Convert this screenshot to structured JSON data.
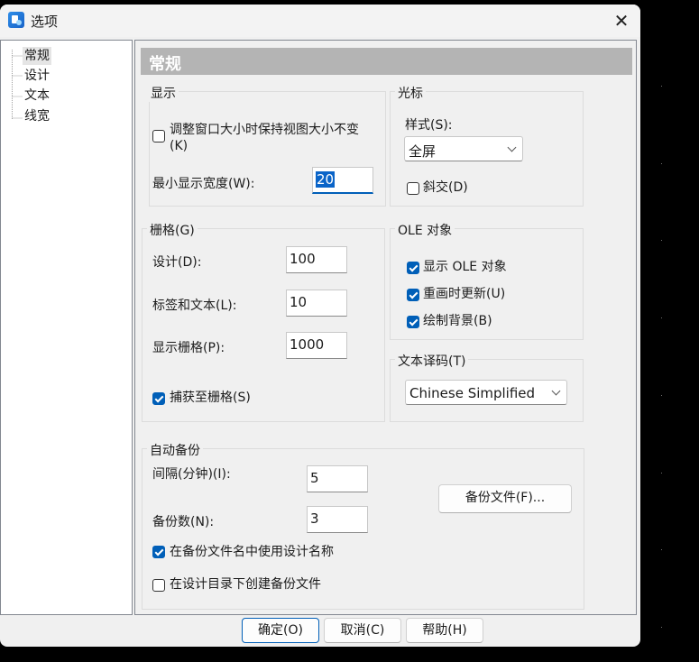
{
  "window": {
    "title": "选项",
    "close_symbol": "✕"
  },
  "tree": {
    "items": [
      "常规",
      "设计",
      "文本",
      "线宽"
    ],
    "selected": "常规"
  },
  "page_header": "常规",
  "display": {
    "group_label": "显示",
    "keep_view_size_line1": "调整窗口大小时保持视图大小不变",
    "keep_view_size_line2": "(K)",
    "keep_view_size_checked": false,
    "min_width_label": "最小显示宽度(W):",
    "min_width_value": "20"
  },
  "cursor": {
    "group_label": "光标",
    "style_label": "样式(S):",
    "style_value": "全屏",
    "oblique_label": "斜交(D)",
    "oblique_checked": false
  },
  "grid": {
    "group_label": "栅格(G)",
    "design_label": "设计(D):",
    "design_value": "100",
    "label_text_label": "标签和文本(L):",
    "label_text_value": "10",
    "display_label": "显示栅格(P):",
    "display_value": "1000",
    "snap_label": "捕获至栅格(S)",
    "snap_checked": true
  },
  "ole": {
    "group_label": "OLE 对象",
    "show_label": "显示 OLE 对象",
    "redraw_label": "重画时更新(U)",
    "draw_bg_label": "绘制背景(B)"
  },
  "encoding": {
    "group_label": "文本译码(T)",
    "value": "Chinese Simplified"
  },
  "backup": {
    "group_label": "自动备份",
    "interval_label": "间隔(分钟)(I):",
    "interval_value": "5",
    "count_label": "备份数(N):",
    "count_value": "3",
    "files_button": "备份文件(F)...",
    "use_design_name_label": "在备份文件名中使用设计名称",
    "use_design_name_checked": true,
    "in_design_dir_label": "在设计目录下创建备份文件",
    "in_design_dir_checked": false
  },
  "buttons": {
    "ok": "确定(O)",
    "cancel": "取消(C)",
    "help": "帮助(H)"
  },
  "colors": {
    "accent": "#005fb8",
    "header_bar": "#b4b4b4",
    "selection": "#0a64c8"
  }
}
